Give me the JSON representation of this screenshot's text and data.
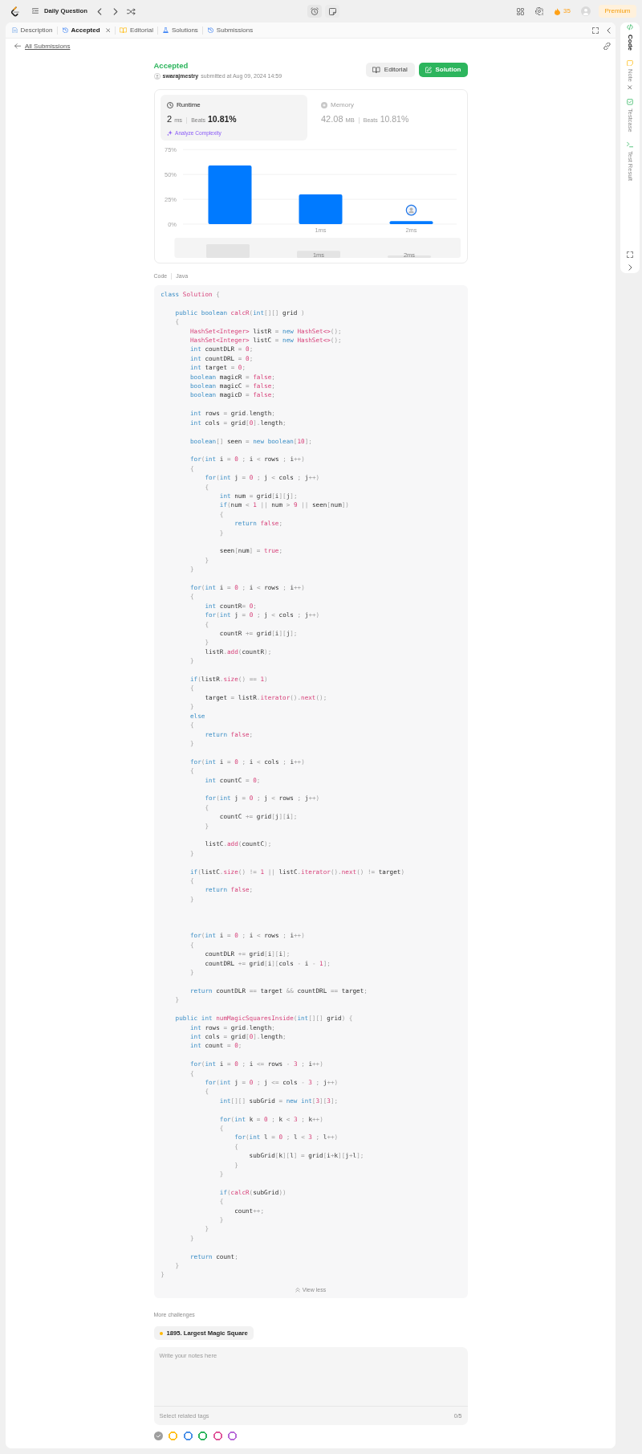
{
  "top_bar": {
    "title": "Daily Question",
    "streak": "35",
    "premium": "Premium"
  },
  "tabs": [
    {
      "label": "Description",
      "kind": "description",
      "selected": false,
      "closable": false
    },
    {
      "label": "Accepted",
      "kind": "result",
      "selected": true,
      "closable": true
    },
    {
      "label": "Editorial",
      "kind": "editorial",
      "selected": false,
      "closable": false
    },
    {
      "label": "Solutions",
      "kind": "solutions",
      "selected": false,
      "closable": false
    },
    {
      "label": "Submissions",
      "kind": "submissions",
      "selected": false,
      "closable": false
    }
  ],
  "back_link": "All Submissions",
  "result": {
    "status": "Accepted",
    "user": "swarajmestry",
    "submitted": "submitted at Aug 09, 2024 14:59",
    "buttons": [
      {
        "label": "Editorial",
        "kind": "editorial"
      },
      {
        "label": "Solution",
        "kind": "solution"
      }
    ],
    "stats": [
      {
        "kind": "runtime",
        "label": "Runtime",
        "value": "2",
        "unit": "ms",
        "beats_label": "Beats",
        "beats": "10.81%",
        "link": "Analyze Complexity",
        "selected": true
      },
      {
        "kind": "memory",
        "label": "Memory",
        "value": "42.08",
        "unit": "MB",
        "beats_label": "Beats",
        "beats": "10.81%",
        "selected": false
      }
    ],
    "chart_data": {
      "type": "bar",
      "categories": [
        null,
        "1ms",
        "2ms"
      ],
      "values": [
        59,
        30,
        3
      ],
      "ylim": [
        0,
        75
      ],
      "yticks": [
        {
          "value": 0,
          "label": "0%"
        },
        {
          "value": 25,
          "label": "25%"
        },
        {
          "value": 50,
          "label": "50%"
        },
        {
          "value": 75,
          "label": "75%"
        }
      ],
      "annotations": [
        {
          "x": "2ms"
        }
      ]
    },
    "overview": {
      "labels": [
        "1ms",
        "2ms"
      ]
    }
  },
  "code": {
    "label": "Code",
    "language": "Java",
    "toggle": "View less",
    "lines": [
      {
        "kind": "code",
        "parts": [
          {
            "kind": "kw",
            "text": "class "
          },
          {
            "kind": "hl",
            "text": "Solution"
          },
          " {"
        ]
      },
      {
        "kind": "blank"
      },
      {
        "kind": "code",
        "parts": [
          {
            "kind": "kw",
            "text": "    public boolean "
          },
          {
            "kind": "hl",
            "text": "calcR"
          },
          "(",
          {
            "kind": "kw",
            "text": "int"
          },
          "[][] grid )"
        ]
      },
      {
        "kind": "code",
        "parts": [
          "    {"
        ]
      },
      {
        "kind": "code",
        "parts": [
          {
            "kind": "hl",
            "text": "        HashSet<Integer>"
          },
          " listR = ",
          {
            "kind": "kw",
            "text": "new "
          },
          {
            "kind": "hl",
            "text": "HashSet<>"
          },
          "();"
        ]
      },
      {
        "kind": "code",
        "parts": [
          {
            "kind": "hl",
            "text": "        HashSet<Integer>"
          },
          " listC = ",
          {
            "kind": "kw",
            "text": "new "
          },
          {
            "kind": "hl",
            "text": "HashSet<>"
          },
          "();"
        ]
      },
      {
        "kind": "code",
        "parts": [
          {
            "kind": "kw",
            "text": "        int"
          },
          " countDLR = 0;"
        ]
      },
      {
        "kind": "code",
        "parts": [
          {
            "kind": "kw",
            "text": "        int"
          },
          " countDRL = 0;"
        ]
      },
      {
        "kind": "code",
        "parts": [
          {
            "kind": "kw",
            "text": "        int"
          },
          " target = 0;"
        ]
      },
      {
        "kind": "code",
        "parts": [
          {
            "kind": "kw",
            "text": "        boolean"
          },
          " magicR = ",
          {
            "kind": "hl",
            "text": "false"
          },
          ";"
        ]
      },
      {
        "kind": "code",
        "parts": [
          {
            "kind": "kw",
            "text": "        boolean"
          },
          " magicC = ",
          {
            "kind": "hl",
            "text": "false"
          },
          ";"
        ]
      },
      {
        "kind": "code",
        "parts": [
          {
            "kind": "kw",
            "text": "        boolean"
          },
          " magicD = ",
          {
            "kind": "hl",
            "text": "false"
          },
          ";"
        ]
      },
      {
        "kind": "blank"
      },
      {
        "kind": "code",
        "parts": [
          {
            "kind": "kw",
            "text": "        int"
          },
          " rows = grid.length;"
        ]
      },
      {
        "kind": "code",
        "parts": [
          {
            "kind": "kw",
            "text": "        int"
          },
          " cols = grid[0].length;"
        ]
      },
      {
        "kind": "blank"
      },
      {
        "kind": "code",
        "parts": [
          {
            "kind": "kw",
            "text": "        boolean"
          },
          "[] seen = ",
          {
            "kind": "kw",
            "text": "new boolean"
          },
          "[10];"
        ]
      },
      {
        "kind": "blank"
      },
      {
        "kind": "code",
        "parts": [
          {
            "kind": "kw",
            "text": "        for"
          },
          "(",
          {
            "kind": "kw",
            "text": "int"
          },
          " i = 0 ; i < rows ; i++)"
        ]
      },
      {
        "kind": "code",
        "parts": [
          "        {"
        ]
      },
      {
        "kind": "code",
        "parts": [
          {
            "kind": "kw",
            "text": "            for"
          },
          "(",
          {
            "kind": "kw",
            "text": "int"
          },
          " j = 0 ; j < cols ; j++)"
        ]
      },
      {
        "kind": "code",
        "parts": [
          "            {"
        ]
      },
      {
        "kind": "code",
        "parts": [
          {
            "kind": "kw",
            "text": "                int"
          },
          " num = grid[i][j];"
        ]
      },
      {
        "kind": "code",
        "parts": [
          {
            "kind": "kw",
            "text": "                if"
          },
          "(num < 1 || num > 9 || seen[num])"
        ]
      },
      {
        "kind": "code",
        "parts": [
          "                {"
        ]
      },
      {
        "kind": "code",
        "parts": [
          {
            "kind": "kw",
            "text": "                    return "
          },
          {
            "kind": "hl",
            "text": "false"
          },
          ";"
        ]
      },
      {
        "kind": "code",
        "parts": [
          "                }"
        ]
      },
      {
        "kind": "blank"
      },
      {
        "kind": "code",
        "parts": [
          "                seen[num] = ",
          {
            "kind": "hl",
            "text": "true"
          },
          ";"
        ]
      },
      {
        "kind": "code",
        "parts": [
          "            }"
        ]
      },
      {
        "kind": "code",
        "parts": [
          "        }"
        ]
      },
      {
        "kind": "blank"
      },
      {
        "kind": "code",
        "parts": [
          {
            "kind": "kw",
            "text": "        for"
          },
          "(",
          {
            "kind": "kw",
            "text": "int"
          },
          " i = 0 ; i < rows ; i++)"
        ]
      },
      {
        "kind": "code",
        "parts": [
          "        {"
        ]
      },
      {
        "kind": "code",
        "parts": [
          {
            "kind": "kw",
            "text": "            int"
          },
          " countR= 0;"
        ]
      },
      {
        "kind": "code",
        "parts": [
          {
            "kind": "kw",
            "text": "            for"
          },
          "(",
          {
            "kind": "kw",
            "text": "int"
          },
          " j = 0 ; j < cols ; j++)"
        ]
      },
      {
        "kind": "code",
        "parts": [
          "            {"
        ]
      },
      {
        "kind": "code",
        "parts": [
          "                countR += grid[i][j];"
        ]
      },
      {
        "kind": "code",
        "parts": [
          "            }"
        ]
      },
      {
        "kind": "code",
        "parts": [
          "            listR.",
          {
            "kind": "hl",
            "text": "add"
          },
          "(countR);"
        ]
      },
      {
        "kind": "code",
        "parts": [
          "        }"
        ]
      },
      {
        "kind": "blank"
      },
      {
        "kind": "code",
        "parts": [
          {
            "kind": "kw",
            "text": "        if"
          },
          "(listR.",
          {
            "kind": "hl",
            "text": "size"
          },
          "() == 1)"
        ]
      },
      {
        "kind": "code",
        "parts": [
          "        {"
        ]
      },
      {
        "kind": "code",
        "parts": [
          "            target = listR.",
          {
            "kind": "hl",
            "text": "iterator"
          },
          "().",
          {
            "kind": "hl",
            "text": "next"
          },
          "();"
        ]
      },
      {
        "kind": "code",
        "parts": [
          "        }"
        ]
      },
      {
        "kind": "code",
        "parts": [
          {
            "kind": "kw",
            "text": "        else"
          }
        ]
      },
      {
        "kind": "code",
        "parts": [
          "        {"
        ]
      },
      {
        "kind": "code",
        "parts": [
          {
            "kind": "kw",
            "text": "            return "
          },
          {
            "kind": "hl",
            "text": "false"
          },
          ";"
        ]
      },
      {
        "kind": "code",
        "parts": [
          "        }"
        ]
      },
      {
        "kind": "blank"
      },
      {
        "kind": "code",
        "parts": [
          {
            "kind": "kw",
            "text": "        for"
          },
          "(",
          {
            "kind": "kw",
            "text": "int"
          },
          " i = 0 ; i < cols ; i++)"
        ]
      },
      {
        "kind": "code",
        "parts": [
          "        {"
        ]
      },
      {
        "kind": "code",
        "parts": [
          {
            "kind": "kw",
            "text": "            int"
          },
          " countC = 0;"
        ]
      },
      {
        "kind": "blank"
      },
      {
        "kind": "code",
        "parts": [
          {
            "kind": "kw",
            "text": "            for"
          },
          "(",
          {
            "kind": "kw",
            "text": "int"
          },
          " j = 0 ; j < rows ; j++)"
        ]
      },
      {
        "kind": "code",
        "parts": [
          "            {"
        ]
      },
      {
        "kind": "code",
        "parts": [
          "                countC += grid[j][i];"
        ]
      },
      {
        "kind": "code",
        "parts": [
          "            }"
        ]
      },
      {
        "kind": "blank"
      },
      {
        "kind": "code",
        "parts": [
          "            listC.",
          {
            "kind": "hl",
            "text": "add"
          },
          "(countC);"
        ]
      },
      {
        "kind": "code",
        "parts": [
          "        }"
        ]
      },
      {
        "kind": "blank"
      },
      {
        "kind": "code",
        "parts": [
          {
            "kind": "kw",
            "text": "        if"
          },
          "(listC.",
          {
            "kind": "hl",
            "text": "size"
          },
          "() != 1 || listC.",
          {
            "kind": "hl",
            "text": "iterator"
          },
          "().",
          {
            "kind": "hl",
            "text": "next"
          },
          "() != target)"
        ]
      },
      {
        "kind": "code",
        "parts": [
          "        {"
        ]
      },
      {
        "kind": "code",
        "parts": [
          {
            "kind": "kw",
            "text": "            return "
          },
          {
            "kind": "hl",
            "text": "false"
          },
          ";"
        ]
      },
      {
        "kind": "code",
        "parts": [
          "        }"
        ]
      },
      {
        "kind": "blank"
      },
      {
        "kind": "blank"
      },
      {
        "kind": "blank"
      },
      {
        "kind": "code",
        "parts": [
          {
            "kind": "kw",
            "text": "        for"
          },
          "(",
          {
            "kind": "kw",
            "text": "int"
          },
          " i = 0 ; i < rows ; i++)"
        ]
      },
      {
        "kind": "code",
        "parts": [
          "        {"
        ]
      },
      {
        "kind": "code",
        "parts": [
          "            countDLR += grid[i][i];"
        ]
      },
      {
        "kind": "code",
        "parts": [
          "            countDRL += grid[i][cols - i - 1];"
        ]
      },
      {
        "kind": "code",
        "parts": [
          "        }"
        ]
      },
      {
        "kind": "blank"
      },
      {
        "kind": "code",
        "parts": [
          {
            "kind": "kw",
            "text": "        return"
          },
          " countDLR == target && countDRL == target;"
        ]
      },
      {
        "kind": "code",
        "parts": [
          "    }"
        ]
      },
      {
        "kind": "blank"
      },
      {
        "kind": "code",
        "parts": [
          {
            "kind": "kw",
            "text": "    public int "
          },
          {
            "kind": "hl",
            "text": "numMagicSquaresInside"
          },
          "(",
          {
            "kind": "kw",
            "text": "int"
          },
          "[][] grid) {"
        ]
      },
      {
        "kind": "code",
        "parts": [
          {
            "kind": "kw",
            "text": "        int"
          },
          " rows = grid.length;"
        ]
      },
      {
        "kind": "code",
        "parts": [
          {
            "kind": "kw",
            "text": "        int"
          },
          " cols = grid[0].length;"
        ]
      },
      {
        "kind": "code",
        "parts": [
          {
            "kind": "kw",
            "text": "        int"
          },
          " count = 0;"
        ]
      },
      {
        "kind": "blank"
      },
      {
        "kind": "code",
        "parts": [
          {
            "kind": "kw",
            "text": "        for"
          },
          "(",
          {
            "kind": "kw",
            "text": "int"
          },
          " i = 0 ; i <= rows - 3 ; i++)"
        ]
      },
      {
        "kind": "code",
        "parts": [
          "        {"
        ]
      },
      {
        "kind": "code",
        "parts": [
          {
            "kind": "kw",
            "text": "            for"
          },
          "(",
          {
            "kind": "kw",
            "text": "int"
          },
          " j = 0 ; j <= cols - 3 ; j++)"
        ]
      },
      {
        "kind": "code",
        "parts": [
          "            {"
        ]
      },
      {
        "kind": "code",
        "parts": [
          {
            "kind": "kw",
            "text": "                int"
          },
          "[][] subGrid = ",
          {
            "kind": "kw",
            "text": "new int"
          },
          "[3][3];"
        ]
      },
      {
        "kind": "blank"
      },
      {
        "kind": "code",
        "parts": [
          {
            "kind": "kw",
            "text": "                for"
          },
          "(",
          {
            "kind": "kw",
            "text": "int"
          },
          " k = 0 ; k < 3 ; k++)"
        ]
      },
      {
        "kind": "code",
        "parts": [
          "                {"
        ]
      },
      {
        "kind": "code",
        "parts": [
          {
            "kind": "kw",
            "text": "                    for"
          },
          "(",
          {
            "kind": "kw",
            "text": "int"
          },
          " l = 0 ; l < 3 ; l++)"
        ]
      },
      {
        "kind": "code",
        "parts": [
          "                    {"
        ]
      },
      {
        "kind": "code",
        "parts": [
          "                        subGrid[k][l] = grid[i+k][j+l];"
        ]
      },
      {
        "kind": "code",
        "parts": [
          "                    }"
        ]
      },
      {
        "kind": "code",
        "parts": [
          "                }"
        ]
      },
      {
        "kind": "blank"
      },
      {
        "kind": "code",
        "parts": [
          {
            "kind": "kw",
            "text": "                if"
          },
          "(",
          {
            "kind": "hl",
            "text": "calcR"
          },
          "(subGrid))"
        ]
      },
      {
        "kind": "code",
        "parts": [
          "                {"
        ]
      },
      {
        "kind": "code",
        "parts": [
          "                    count++;"
        ]
      },
      {
        "kind": "code",
        "parts": [
          "                }"
        ]
      },
      {
        "kind": "code",
        "parts": [
          "            }"
        ]
      },
      {
        "kind": "code",
        "parts": [
          "        }"
        ]
      },
      {
        "kind": "blank"
      },
      {
        "kind": "code",
        "parts": [
          {
            "kind": "kw",
            "text": "        return"
          },
          " count;"
        ]
      },
      {
        "kind": "code",
        "parts": [
          "    }"
        ]
      },
      {
        "kind": "code",
        "parts": [
          "}"
        ]
      }
    ]
  },
  "more_challenges": {
    "title": "More challenges",
    "items": [
      {
        "label": "1895. Largest Magic Square",
        "color": "#ffb800"
      }
    ]
  },
  "notes": {
    "placeholder": "Write your notes here",
    "tags_placeholder": "Select related tags",
    "tag_count": "0/5",
    "colors": [
      {
        "color": "#9e9e9e",
        "selected": true
      },
      {
        "color": "#ffc01e",
        "selected": false
      },
      {
        "color": "#4a8fe7",
        "selected": false
      },
      {
        "color": "#2db55d",
        "selected": false
      },
      {
        "color": "#e0579a",
        "selected": false
      },
      {
        "color": "#b86ad8",
        "selected": false
      }
    ]
  },
  "side_tabs": [
    {
      "label": "Code",
      "kind": "code",
      "selected": true,
      "closable": false
    },
    {
      "label": "Note",
      "kind": "note",
      "selected": false,
      "closable": true
    },
    {
      "label": "Testcase",
      "kind": "testcase",
      "selected": false,
      "closable": false
    },
    {
      "label": "Test Result",
      "kind": "result",
      "selected": false,
      "closable": false
    }
  ]
}
